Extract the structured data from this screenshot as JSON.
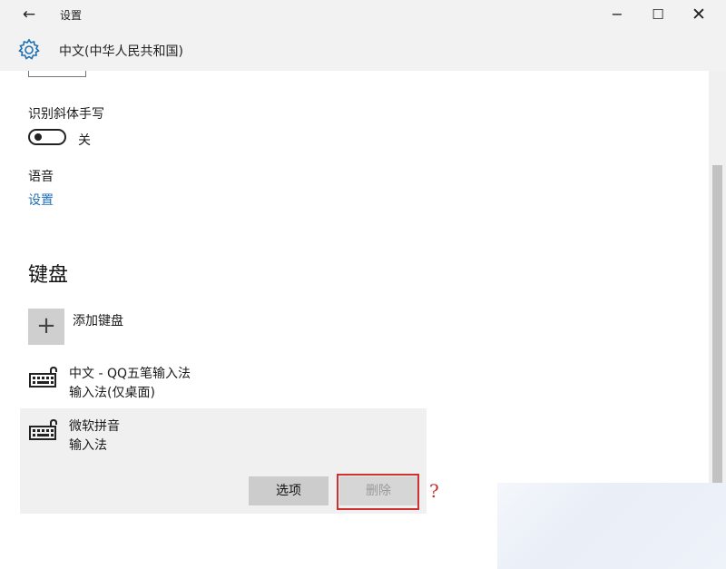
{
  "window": {
    "title": "设置",
    "controls": {
      "minimize": "−",
      "maximize": "☐",
      "close": "✕"
    }
  },
  "header": {
    "icon": "gear-icon",
    "title": "中文(中华人民共和国)"
  },
  "handwriting": {
    "label": "识别斜体手写",
    "toggle_state": "关",
    "toggle_on": false
  },
  "speech": {
    "label": "语音",
    "link": "设置"
  },
  "keyboard": {
    "section_title": "键盘",
    "add_label": "添加键盘",
    "items": [
      {
        "name": "中文 - QQ五笔输入法",
        "type": "输入法(仅桌面)",
        "icon": "keyboard-icon"
      },
      {
        "name": "微软拼音",
        "type": "输入法",
        "icon": "keyboard-icon"
      }
    ],
    "buttons": {
      "options": "选项",
      "delete": "删除"
    },
    "annotation": "?"
  },
  "colors": {
    "accent_link": "#1f6fb5",
    "highlight": "#d03030"
  }
}
